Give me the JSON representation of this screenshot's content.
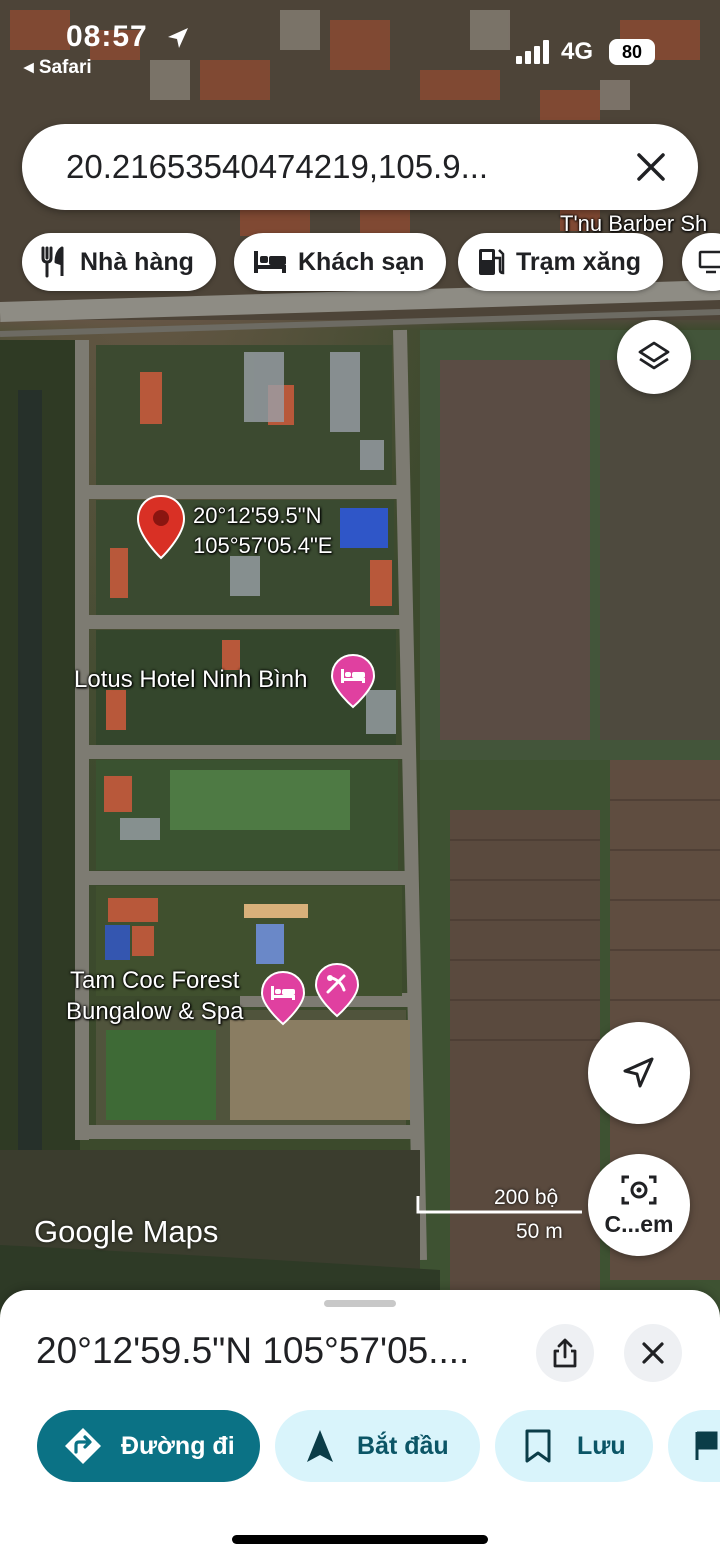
{
  "status_bar": {
    "time": "08:57",
    "back_app": "◂ Safari",
    "network": "4G",
    "battery": "80",
    "location_icon": "location-arrow-icon",
    "signal_icon": "signal-bars-icon"
  },
  "search": {
    "value": "20.21653540474219,105.9...",
    "clear_icon": "close-icon"
  },
  "chips": [
    {
      "label": "Nhà hàng",
      "icon": "restaurant-icon"
    },
    {
      "label": "Khách sạn",
      "icon": "hotel-bed-icon"
    },
    {
      "label": "Trạm xăng",
      "icon": "gas-station-icon"
    }
  ],
  "map": {
    "top_street_label": "T'nu Barber Sh",
    "pin": {
      "line1": "20°12'59.5\"N",
      "line2": "105°57'05.4\"E",
      "color": "#d93025"
    },
    "places": [
      {
        "name": "Lotus Hotel Ninh Bình",
        "icon": "hotel-bed-icon"
      },
      {
        "name_line1": "Tam Coc Forest",
        "name_line2": "Bungalow & Spa",
        "icon": "hotel-bed-icon",
        "extra_icon": "spa-icon"
      }
    ],
    "place_pin_color": "#e040a0",
    "logo": "Google Maps",
    "scale": {
      "top": "200 bộ",
      "bottom": "50 m"
    },
    "layers_icon": "layers-icon",
    "locate_icon": "navigation-arrow-icon",
    "camera_label": "C...em",
    "camera_icon": "camera-search-icon"
  },
  "sheet": {
    "title": "20°12'59.5\"N 105°57'05....",
    "share_icon": "share-icon",
    "close_icon": "close-icon",
    "actions": [
      {
        "label": "Đường đi",
        "icon": "directions-icon",
        "accent": "#0b7285"
      },
      {
        "label": "Bắt đầu",
        "icon": "navigation-arrow-icon"
      },
      {
        "label": "Lưu",
        "icon": "bookmark-icon"
      }
    ]
  }
}
